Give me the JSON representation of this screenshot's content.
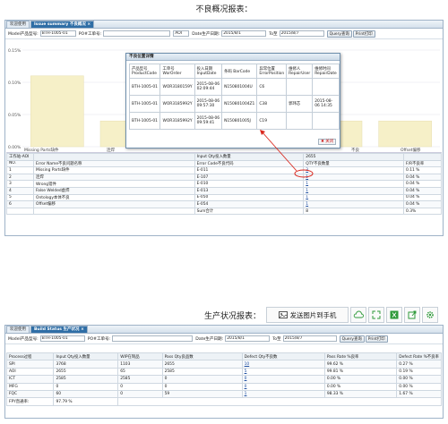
{
  "heading1": "不良概况报表：",
  "panel1": {
    "tabs": [
      {
        "label": "欢迎使用"
      },
      {
        "label": "Issue summary 不良概况 ×"
      }
    ],
    "filter": {
      "model_label": "Model产品型号:",
      "model_value": "BTH-1005-01",
      "po_label": "PO#工单号:",
      "po_value": "",
      "station_value": "AOI",
      "date_label": "Date生产日期:",
      "date_from": "2015/8/1",
      "to_label": "To至",
      "date_to": "2015/8/7",
      "query_btn": "Query查询",
      "print_btn": "Print打印"
    },
    "chart": {
      "ytick_top": "0.15%",
      "ytick_mid1": "0.10%",
      "ytick_mid2": "0.05%",
      "ytick_bot": "0.00%",
      "xlabel_1": "Missing Parts缺件",
      "xlabel_2": "连焊",
      "xlabel_5": "不良",
      "xlabel_6": "Offset偏移"
    },
    "table": {
      "top_row": [
        "工作站-AOI",
        "",
        "Input Qty投入数量",
        "2655",
        ""
      ],
      "header": [
        "NO.",
        "Error Name不良问题名称",
        "Error Code不良代码",
        "QTY不良数量",
        "F/R不良率"
      ],
      "rows": [
        [
          "1",
          "Missing Parts缺件",
          "E-011",
          "3",
          "0.11 %"
        ],
        [
          "2",
          "连焊",
          "E-107",
          "1",
          "0.04 %"
        ],
        [
          "3",
          "Wrong错件",
          "E-010",
          "1",
          "0.04 %"
        ],
        [
          "4",
          "False Welded虚焊",
          "E-013",
          "1",
          "0.04 %"
        ],
        [
          "5",
          "Ontology本体不良",
          "E-050",
          "1",
          "0.04 %"
        ],
        [
          "6",
          "Offset偏移",
          "E-054",
          "1",
          "0.04 %"
        ]
      ],
      "sum_row": [
        "",
        "",
        "Sum合计",
        "8",
        "0.3%"
      ]
    }
  },
  "chart_data": {
    "type": "bar",
    "categories": [
      "Missing Parts缺件",
      "连焊",
      "Wrong错件",
      "False Welded虚焊",
      "Ontology本体不良",
      "Offset偏移"
    ],
    "values": [
      0.11,
      0.04,
      0.04,
      0.04,
      0.04,
      0.04
    ],
    "ylim": [
      0,
      0.15
    ],
    "yticks": [
      "0.00%",
      "0.05%",
      "0.10%",
      "0.15%"
    ],
    "bar_color": "#f6f0c8"
  },
  "popup": {
    "title": "不良位置详情",
    "header": [
      "产品型号 ProductCode",
      "工单号 WorOrder",
      "投入日期 InputDate",
      "条码 BarCode",
      "异常位置 ErrorPosition",
      "维修人 RepairUser",
      "维修时间 RepairDate"
    ],
    "rows": [
      [
        "BTH-1005-01",
        "WOR3180159Y",
        "2015-08-06 02:09:44",
        "N150801004U",
        "C6",
        "",
        ""
      ],
      [
        "BTH-1005-01",
        "WOR3185992Y",
        "2015-08-06 09:57:30",
        "N150801004Z1",
        "C38",
        "郭玮芯",
        "2015-08-06 14:35"
      ],
      [
        "BTH-1005-01",
        "WOR3185992Y",
        "2015-08-06 09:59:41",
        "N150801005J",
        "C19",
        "",
        ""
      ]
    ],
    "close_label": "关闭",
    "accent": "#d9261c"
  },
  "toolbar2": {
    "title": "生产状况报表：",
    "send_label": "发送图片到手机"
  },
  "panel2": {
    "tabs": [
      {
        "label": "欢迎使用"
      },
      {
        "label": "Build Status 生产状况 ×"
      }
    ],
    "filter": {
      "model_label": "Model产品型号:",
      "model_value": "BTH-1005-01",
      "po_label": "PO#工单号:",
      "po_value": "",
      "date_label": "Date生产日期:",
      "date_from": "2015/8/1",
      "to_label": "To至",
      "date_to": "2015/8/7",
      "query_btn": "Query查询",
      "print_btn": "Print打印"
    },
    "table": {
      "header": [
        "Process过程",
        "Input Qty投入数量",
        "WIP在制品",
        "Pass Qty良品数",
        "Defect Qty不良数",
        "Pass Rate %良率",
        "Defect Rate %不良率"
      ],
      "rows": [
        [
          "SPI",
          "3768",
          "1103",
          "2655",
          "10",
          "99.62 %",
          "0.27 %"
        ],
        [
          "AOI",
          "2655",
          "65",
          "2585",
          "5",
          "99.81 %",
          "0.19 %"
        ],
        [
          "ICT",
          "2585",
          "2585",
          "0",
          "0",
          "0.00 %",
          "0.00 %"
        ],
        [
          "MFG",
          "0",
          "0",
          "0",
          "0",
          "0.00 %",
          "0.00 %"
        ],
        [
          "FQC",
          "60",
          "0",
          "59",
          "1",
          "98.33 %",
          "1.67 %"
        ]
      ],
      "fpy_label": "FPY直通率:",
      "fpy_value": "97.79 %"
    }
  }
}
